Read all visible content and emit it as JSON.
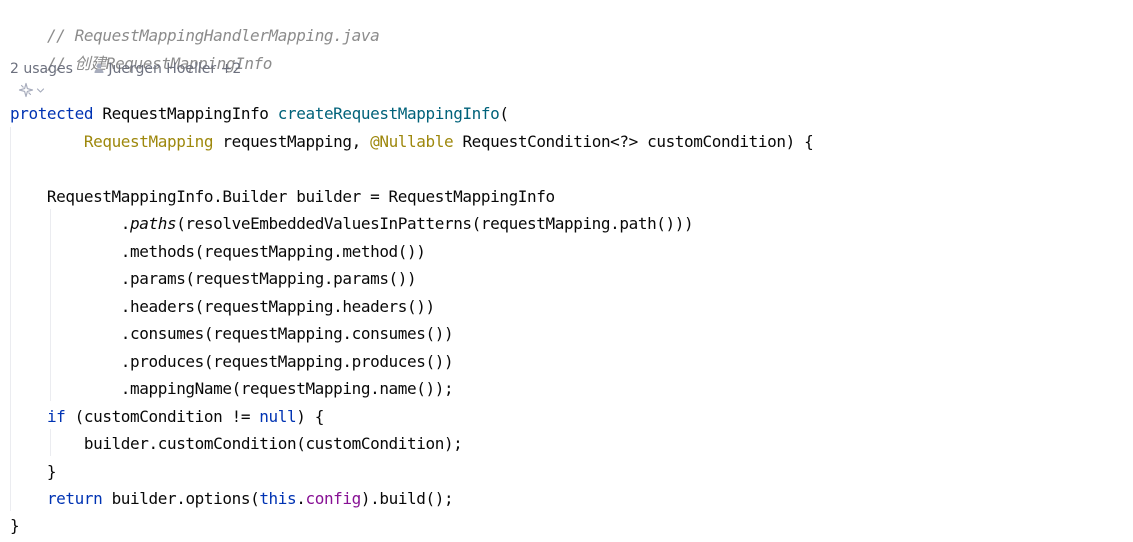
{
  "editor": {
    "comment_file": "// RequestMappingHandlerMapping.java",
    "comment_create": "// 创建RequestMappingInfo",
    "inlay": {
      "usages": "2 usages",
      "authors": "Juergen Hoeller +2"
    },
    "icons": {
      "person": "person-icon",
      "generate": "ai-generate-icon",
      "dropdown": "chevron-down-icon"
    },
    "code": {
      "l1_kw": "protected",
      "l1_type": " RequestMappingInfo ",
      "l1_method": "createRequestMappingInfo",
      "l1_paren": "(",
      "l2_indent": "        ",
      "l2_type": "RequestMapping",
      "l2_mid": " requestMapping, ",
      "l2_anno": "@Nullable",
      "l2_rest": " RequestCondition<?> customCondition) {",
      "l4": "    RequestMappingInfo.Builder builder = RequestMappingInfo",
      "l5_indent": "            .",
      "l5_static": "paths",
      "l5_rest": "(resolveEmbeddedValuesInPatterns(requestMapping.path()))",
      "l6": "            .methods(requestMapping.method())",
      "l7": "            .params(requestMapping.params())",
      "l8": "            .headers(requestMapping.headers())",
      "l9": "            .consumes(requestMapping.consumes())",
      "l10": "            .produces(requestMapping.produces())",
      "l11": "            .mappingName(requestMapping.name());",
      "l12_indent": "    ",
      "l12_kw": "if",
      "l12_mid": " (customCondition != ",
      "l12_null": "null",
      "l12_end": ") {",
      "l13": "        builder.customCondition(customCondition);",
      "l14": "    }",
      "l15_indent": "    ",
      "l15_kw": "return",
      "l15_mid": " builder.options(",
      "l15_this": "this",
      "l15_dot": ".",
      "l15_field": "config",
      "l15_end": ").build();",
      "l16": "}"
    }
  }
}
